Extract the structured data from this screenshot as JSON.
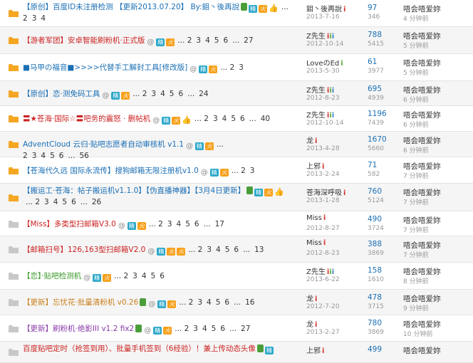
{
  "colors": {
    "folder_orange": "#f5a623",
    "folder_gray": "#c8c8c8",
    "link_blue": "#1a6fb5",
    "link_red": "#cc2222"
  },
  "rows": [
    {
      "title": "【原创】百度ID未注册检测 【更新2013.07.20】 By:鉬丶後再說",
      "pages": [
        "2",
        "3",
        "4"
      ],
      "badges": [
        "pic",
        "jing",
        "fire",
        "thumb"
      ],
      "author": "鉬丶後再說",
      "author_icon": "i",
      "date": "2013-7-16",
      "replies": "97",
      "views": "346",
      "last_user": "唔会唔爱妳",
      "last_time": "4 分钟前",
      "folder": "orange",
      "red": false
    },
    {
      "title": "【游者军团】安卓智能刷粉机·正式版",
      "pages": [
        "2",
        "3",
        "4",
        "5",
        "6",
        "...",
        "27"
      ],
      "badges": [
        "at",
        "jing",
        "fire"
      ],
      "author": "Z先生",
      "author_icon": "iii",
      "date": "2012-10-14",
      "replies": "788",
      "views": "5415",
      "last_user": "唔会唔爱妳",
      "last_time": "5 分钟前",
      "folder": "orange",
      "red": true
    },
    {
      "title": "■马甲の福音■>>>>代替手工解封工具[修改版]",
      "pages": [
        "2",
        "3"
      ],
      "badges": [
        "at",
        "jing",
        "fire"
      ],
      "author": "LoveのEd",
      "author_icon": "i",
      "date": "2013-5-30",
      "replies": "61",
      "views": "3977",
      "last_user": "唔会唔爱妳",
      "last_time": "5 分钟前",
      "folder": "orange",
      "red": false
    },
    {
      "title": "【原创】恋·测免码工具",
      "pages": [
        "2",
        "3",
        "4",
        "5",
        "6",
        "...",
        "24"
      ],
      "badges": [
        "at",
        "jing",
        "fire"
      ],
      "author": "Z先生",
      "author_icon": "iii",
      "date": "2012-8-23",
      "replies": "695",
      "views": "4939",
      "last_user": "唔会唔爱妳",
      "last_time": "6 分钟前",
      "folder": "orange",
      "red": false
    },
    {
      "title": "〓★苍海·国际☆〓吧务的震怒 · 删帖机",
      "pages": [
        "2",
        "3",
        "4",
        "5",
        "6",
        "...",
        "40"
      ],
      "badges": [
        "at",
        "jing",
        "fire",
        "thumb"
      ],
      "author": "Z先生",
      "author_icon": "iii",
      "date": "2012-10-14",
      "replies": "1196",
      "views": "7439",
      "last_user": "唔会唔爱妳",
      "last_time": "6 分钟前",
      "folder": "orange",
      "red": true
    },
    {
      "title": "AdventCloud 云归·贴吧志愿者自动审核机 v1.1",
      "pages": [
        "2",
        "3",
        "4",
        "5",
        "6",
        "...",
        "56"
      ],
      "badges": [
        "at",
        "jing",
        "fire"
      ],
      "author": "龙",
      "author_icon": "i",
      "date": "2013-4-28",
      "replies": "1670",
      "views": "5660",
      "last_user": "唔会唔爱妳",
      "last_time": "6 分钟前",
      "folder": "orange",
      "red": false
    },
    {
      "title": "【苍海代久远 国际永流传】搜狗邮箱无限注册机v1.0",
      "pages": [
        "2",
        "3"
      ],
      "badges": [
        "at",
        "jing",
        "fire"
      ],
      "author": "上邪",
      "author_icon": "i",
      "date": "2013-2-24",
      "replies": "71",
      "views": "582",
      "last_user": "唔会唔爱妳",
      "last_time": "7 分钟前",
      "folder": "orange",
      "red": false,
      "plain": true
    },
    {
      "title": "【搬运工·苍海：帖子搬运机v1.1.0】【伪直播神器】【3月4日更新】",
      "pages": [
        "2",
        "3",
        "4",
        "5",
        "6",
        "...",
        "26"
      ],
      "badges": [
        "pic",
        "jing",
        "fire",
        "thumb"
      ],
      "author": "苍海深呼吸",
      "author_icon": "i",
      "date": "2013-1-28",
      "replies": "760",
      "views": "5124",
      "last_user": "唔会唔爱妳",
      "last_time": "7 分钟前",
      "folder": "orange",
      "red": false
    },
    {
      "title": "【Miss】多类型扫邮箱V3.0",
      "pages": [
        "2",
        "3",
        "4",
        "5",
        "6",
        "...",
        "17"
      ],
      "badges": [
        "at",
        "jing",
        "fire"
      ],
      "author": "Miss",
      "author_icon": "i",
      "date": "2012-8-27",
      "replies": "490",
      "views": "3724",
      "last_user": "唔会唔爱妳",
      "last_time": "7 分钟前",
      "folder": "gray",
      "red": true
    },
    {
      "title": "【邮箱扫号】126,163型扫邮箱V2.0",
      "pages": [
        "2",
        "3",
        "4",
        "5",
        "6",
        "...",
        "13"
      ],
      "badges": [
        "at",
        "jing",
        "fire",
        "fire"
      ],
      "author": "Miss",
      "author_icon": "i",
      "date": "2012-8-23",
      "replies": "388",
      "views": "3869",
      "last_user": "唔会唔爱妳",
      "last_time": "7 分钟前",
      "folder": "gray",
      "red": true
    },
    {
      "title": "【恋】·贴吧检测机",
      "pages": [
        "2",
        "3",
        "4",
        "5",
        "6"
      ],
      "badges": [
        "at",
        "jing",
        "fire"
      ],
      "author": "Z先生",
      "author_icon": "iii",
      "date": "2013-6-22",
      "replies": "158",
      "views": "1610",
      "last_user": "唔会唔爱妳",
      "last_time": "8 分钟前",
      "folder": "gray",
      "red": false,
      "green": true
    },
    {
      "title": "【更新】忘忧花·批量清粉机 v0.26",
      "pages": [
        "2",
        "3",
        "4",
        "5",
        "6",
        "...",
        "16"
      ],
      "badges": [
        "pic",
        "at",
        "jing",
        "fire"
      ],
      "author": "龙",
      "author_icon": "i",
      "date": "2012-7-20",
      "replies": "478",
      "views": "3715",
      "last_user": "唔会唔爱妳",
      "last_time": "9 分钟前",
      "folder": "gray",
      "red": false,
      "orange": true
    },
    {
      "title": "【更新】刷粉机·绝影III v1.2 fix2",
      "pages": [
        "2",
        "3",
        "4",
        "5",
        "6",
        "...",
        "27"
      ],
      "badges": [
        "pic",
        "at",
        "jing",
        "fire"
      ],
      "author": "龙",
      "author_icon": "i",
      "date": "2013-2-27",
      "replies": "780",
      "views": "3869",
      "last_user": "唔会唔爱妳",
      "last_time": "10 分钟前",
      "folder": "gray",
      "red": false,
      "purple": true
    },
    {
      "title": "百度贴吧定时（抢签到用）、批量手机签到（6经验）！兼上传动态头像",
      "pages": [],
      "badges": [
        "pic",
        "jing"
      ],
      "author": "上邪",
      "author_icon": "i",
      "date": "",
      "replies": "499",
      "views": "",
      "last_user": "唔会唔爱妳",
      "last_time": "",
      "folder": "gray",
      "red": true
    }
  ]
}
